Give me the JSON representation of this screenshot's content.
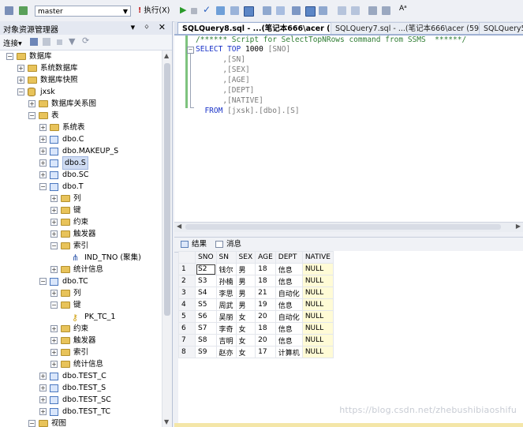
{
  "toolbar": {
    "database": "master",
    "execute_label": "执行(X)"
  },
  "object_explorer": {
    "title": "对象资源管理器",
    "pin_controls": "▾ ᛜ ✕",
    "connect_label": "连接▾",
    "tree": [
      {
        "label": "数据库",
        "icon": "folder",
        "expanded": true
      },
      {
        "label": "系统数据库",
        "icon": "folder",
        "expanded": false
      },
      {
        "label": "数据库快照",
        "icon": "folder",
        "expanded": false
      },
      {
        "label": "jxsk",
        "icon": "database",
        "expanded": true
      },
      {
        "label": "数据库关系图",
        "icon": "folder",
        "expanded": false
      },
      {
        "label": "表",
        "icon": "folder",
        "expanded": true
      },
      {
        "label": "系统表",
        "icon": "folder",
        "expanded": false
      },
      {
        "label": "dbo.C",
        "icon": "table",
        "expanded": false
      },
      {
        "label": "dbo.MAKEUP_S",
        "icon": "table",
        "expanded": false
      },
      {
        "label": "dbo.S",
        "icon": "table",
        "expanded": false,
        "selected": true
      },
      {
        "label": "dbo.SC",
        "icon": "table",
        "expanded": false
      },
      {
        "label": "dbo.T",
        "icon": "table",
        "expanded": true
      },
      {
        "label": "列",
        "icon": "folder",
        "expanded": false
      },
      {
        "label": "键",
        "icon": "folder",
        "expanded": false
      },
      {
        "label": "约束",
        "icon": "folder",
        "expanded": false
      },
      {
        "label": "触发器",
        "icon": "folder",
        "expanded": false
      },
      {
        "label": "索引",
        "icon": "folder",
        "expanded": true
      },
      {
        "label": "IND_TNO (聚集)",
        "icon": "index",
        "expanded": null
      },
      {
        "label": "统计信息",
        "icon": "folder",
        "expanded": false
      },
      {
        "label": "dbo.TC",
        "icon": "table",
        "expanded": true
      },
      {
        "label": "列",
        "icon": "folder",
        "expanded": false
      },
      {
        "label": "键",
        "icon": "folder",
        "expanded": true
      },
      {
        "label": "PK_TC_1",
        "icon": "key",
        "expanded": null
      },
      {
        "label": "约束",
        "icon": "folder",
        "expanded": false
      },
      {
        "label": "触发器",
        "icon": "folder",
        "expanded": false
      },
      {
        "label": "索引",
        "icon": "folder",
        "expanded": false
      },
      {
        "label": "统计信息",
        "icon": "folder",
        "expanded": false
      },
      {
        "label": "dbo.TEST_C",
        "icon": "table",
        "expanded": false
      },
      {
        "label": "dbo.TEST_S",
        "icon": "table",
        "expanded": false
      },
      {
        "label": "dbo.TEST_SC",
        "icon": "table",
        "expanded": false
      },
      {
        "label": "dbo.TEST_TC",
        "icon": "table",
        "expanded": false
      },
      {
        "label": "视图",
        "icon": "folder",
        "expanded": true
      }
    ]
  },
  "tabs": [
    {
      "label": "SQLQuery8.sql - ...(笔记本666\\acer (64))",
      "active": true
    },
    {
      "label": "SQLQuery7.sql - ...(笔记本666\\acer (59))",
      "active": false
    },
    {
      "label": "SQLQuery5",
      "active": false
    }
  ],
  "editor": {
    "comment": "/****** Script for SelectTopNRows command from SSMS  ******/",
    "select_kw": "SELECT",
    "top_kw": "TOP",
    "top_n": "1000",
    "columns": [
      "[SNO]",
      "[SN]",
      "[SEX]",
      "[AGE]",
      "[DEPT]",
      "[NATIVE]"
    ],
    "from_kw": "FROM",
    "from_target": "[jxsk].[dbo].[S]"
  },
  "results": {
    "tab_results": "结果",
    "tab_messages": "消息",
    "columns": [
      "SNO",
      "SN",
      "SEX",
      "AGE",
      "DEPT",
      "NATIVE"
    ],
    "rows": [
      [
        "1",
        "S2",
        "钱尔",
        "男",
        "18",
        "信息",
        "NULL"
      ],
      [
        "2",
        "S3",
        "孙楠",
        "男",
        "18",
        "信息",
        "NULL"
      ],
      [
        "3",
        "S4",
        "李思",
        "男",
        "21",
        "自动化",
        "NULL"
      ],
      [
        "4",
        "S5",
        "周武",
        "男",
        "19",
        "信息",
        "NULL"
      ],
      [
        "5",
        "S6",
        "吴丽",
        "女",
        "20",
        "自动化",
        "NULL"
      ],
      [
        "6",
        "S7",
        "李奇",
        "女",
        "18",
        "信息",
        "NULL"
      ],
      [
        "7",
        "S8",
        "吉明",
        "女",
        "20",
        "信息",
        "NULL"
      ],
      [
        "8",
        "S9",
        "赵亦",
        "女",
        "17",
        "计算机",
        "NULL"
      ]
    ]
  },
  "watermark": "https://blog.csdn.net/zhebushibiaoshifu"
}
